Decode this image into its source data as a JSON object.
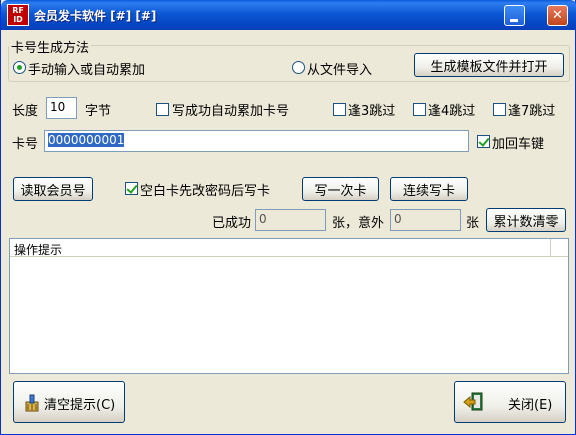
{
  "window": {
    "app_icon": "RF ID",
    "title": "会员发卡软件 [#] [#]"
  },
  "group": {
    "title": "卡号生成方法",
    "manual_label": "手动输入或自动累加",
    "import_label": "从文件导入",
    "template_button": "生成模板文件并打开"
  },
  "length": {
    "label": "长度",
    "value": "10",
    "unit": "字节"
  },
  "options": {
    "auto_inc_label": "写成功自动累加卡号",
    "skip3_label": "逢3跳过",
    "skip4_label": "逢4跳过",
    "skip7_label": "逢7跳过"
  },
  "card": {
    "label": "卡号",
    "value": "0000000001",
    "enter_label": "加回车键"
  },
  "actions": {
    "read_member": "读取会员号",
    "blank_card_label": "空白卡先改密码后写卡",
    "write_once": "写一次卡",
    "write_continuous": "连续写卡"
  },
  "counters": {
    "success_label": "已成功",
    "success_value": "0",
    "unit_comma": "张，意外",
    "fail_value": "0",
    "unit": "张",
    "reset_button": "累计数清零"
  },
  "log": {
    "header": "操作提示"
  },
  "footer": {
    "clear_button": "清空提示(C)",
    "close_button": "关闭(E)"
  }
}
